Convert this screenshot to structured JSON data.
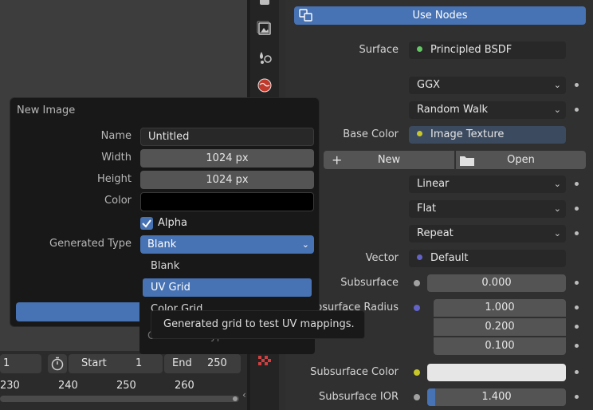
{
  "header": {
    "use_nodes_label": "Use Nodes"
  },
  "props": {
    "surface_label": "Surface",
    "surface_value": "Principled BSDF",
    "distribution": "GGX",
    "subsurface_method": "Random Walk",
    "base_color_label": "Base Color",
    "base_color_value": "Image Texture",
    "new_label": "New",
    "open_label": "Open",
    "interpolation": "Linear",
    "projection": "Flat",
    "extension": "Repeat",
    "vector_label": "Vector",
    "vector_value": "Default",
    "subsurface_label": "Subsurface",
    "subsurface_value": "0.000",
    "subsurface_radius_label": "Subsurface Radius",
    "radius_1": "1.000",
    "radius_2": "0.200",
    "radius_3": "0.100",
    "subsurface_color_label": "Subsurface Color",
    "subsurface_ior_label": "Subsurface IOR",
    "subsurface_ior_value": "1.400"
  },
  "subsurface_ior_fill": 0.06,
  "popup": {
    "title": "New Image",
    "name_label": "Name",
    "name_value": "Untitled",
    "width_label": "Width",
    "width_value": "1024 px",
    "height_label": "Height",
    "height_value": "1024 px",
    "color_label": "Color",
    "alpha_label": "Alpha",
    "generated_type_label": "Generated Type",
    "generated_type_value": "Blank",
    "behind_label": "Generated Type"
  },
  "menu": {
    "items": [
      "Blank",
      "UV Grid",
      "Color Grid"
    ],
    "selected": "UV Grid"
  },
  "tooltip": "Generated grid to test UV mappings.",
  "timeline": {
    "current_frame": "1",
    "start_label": "Start",
    "start_value": "1",
    "end_label": "End",
    "end_value": "250",
    "ruler": [
      "230",
      "240",
      "250",
      "260"
    ]
  },
  "colors": {
    "accent": "#4772b3",
    "socket_green": "#63c763",
    "socket_yellow": "#c7c729",
    "socket_purple": "#6363c7",
    "socket_gray": "#a1a1a1"
  }
}
